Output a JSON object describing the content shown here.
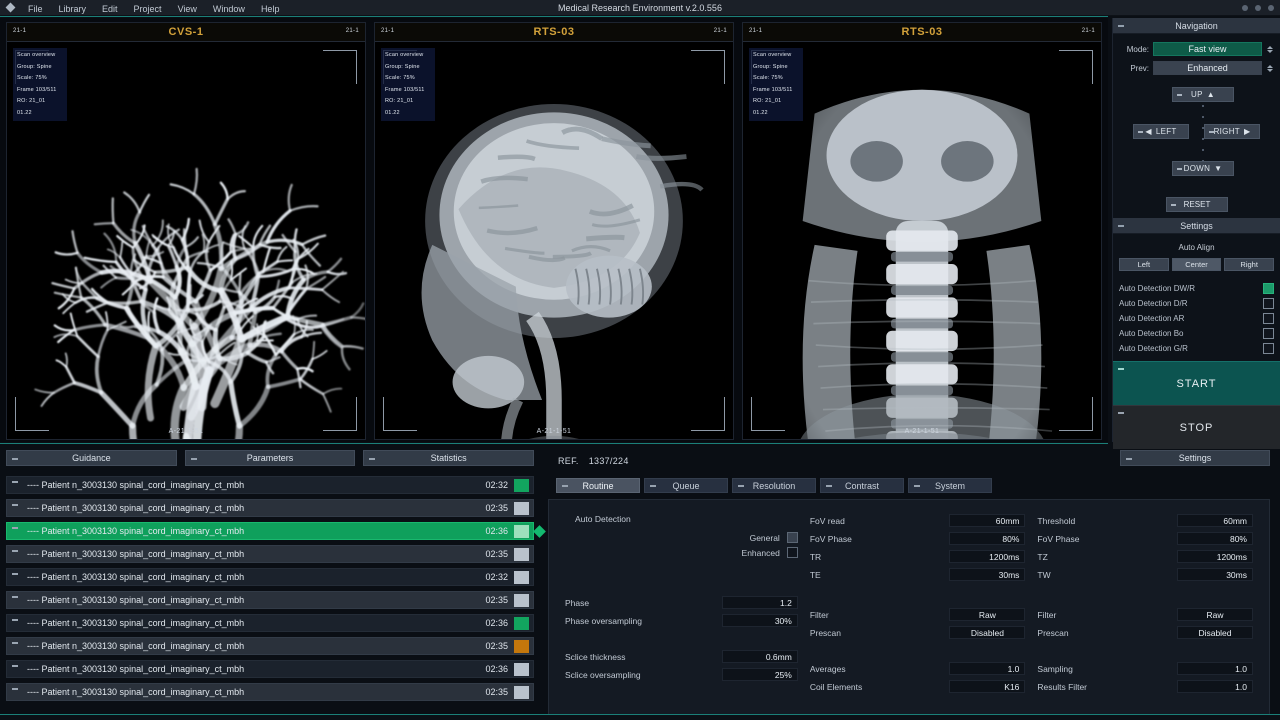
{
  "window": {
    "title": "Medical Research Environment v.2.0.556",
    "menu": [
      "File",
      "Library",
      "Edit",
      "Project",
      "View",
      "Window",
      "Help"
    ],
    "logo_icon": "diamond-icon"
  },
  "viewports": [
    {
      "name": "CVS-1",
      "series_left": "21-1",
      "series_right": "21-1",
      "footer": "A-21-1-51",
      "overlay": [
        "Scan overview",
        "Group: Spine",
        "Scale:  75%",
        "Frame 103/511",
        "RO: 21_01",
        "01.22"
      ]
    },
    {
      "name": "RTS-03",
      "series_left": "21-1",
      "series_right": "21-1",
      "footer": "A-21-1-51",
      "overlay": [
        "Scan overview",
        "Group: Spine",
        "Scale:  75%",
        "Frame 103/511",
        "RO: 21_01",
        "01.22"
      ]
    },
    {
      "name": "RTS-03",
      "series_left": "21-1",
      "series_right": "21-1",
      "footer": "A-21-1-51",
      "overlay": [
        "Scan overview",
        "Group: Spine",
        "Scale:  75%",
        "Frame 103/511",
        "RO: 21_01",
        "01.22"
      ]
    }
  ],
  "navigation": {
    "title": "Navigation",
    "mode_label": "Mode:",
    "mode_value": "Fast view",
    "prev_label": "Prev:",
    "prev_value": "Enhanced",
    "up": "UP",
    "left": "LEFT",
    "right": "RIGHT",
    "down": "DOWN",
    "reset": "RESET"
  },
  "settings": {
    "title": "Settings",
    "auto_align": "Auto Align",
    "align_options": [
      "Left",
      "Center",
      "Right"
    ],
    "align_selected": "Center",
    "detections": [
      {
        "label": "Auto Detection DW/R",
        "checked": true
      },
      {
        "label": "Auto Detection D/R",
        "checked": false
      },
      {
        "label": "Auto Detection AR",
        "checked": false
      },
      {
        "label": "Auto Detection Bo",
        "checked": false
      },
      {
        "label": "Auto Detection G/R",
        "checked": false
      }
    ],
    "start": "START",
    "stop": "STOP"
  },
  "lower_tabs": [
    "Guidance",
    "Parameters",
    "Statistics"
  ],
  "settings_button": "Settings",
  "patient_list": [
    {
      "name": "---- Patient n_3003130 spinal_cord_imaginary_ct_mbh",
      "time": "02:32",
      "status_color": "#12a55f",
      "selected": false,
      "style": "alt"
    },
    {
      "name": "---- Patient n_3003130 spinal_cord_imaginary_ct_mbh",
      "time": "02:35",
      "status_color": "#b9c2cc",
      "selected": false,
      "style": "normal"
    },
    {
      "name": "---- Patient n_3003130 spinal_cord_imaginary_ct_mbh",
      "time": "02:36",
      "status_color": "#9ce0bd",
      "selected": true,
      "style": "sel"
    },
    {
      "name": "---- Patient n_3003130 spinal_cord_imaginary_ct_mbh",
      "time": "02:35",
      "status_color": "#b9c2cc",
      "selected": false,
      "style": "normal"
    },
    {
      "name": "---- Patient n_3003130 spinal_cord_imaginary_ct_mbh",
      "time": "02:32",
      "status_color": "#b9c2cc",
      "selected": false,
      "style": "alt"
    },
    {
      "name": "---- Patient n_3003130 spinal_cord_imaginary_ct_mbh",
      "time": "02:35",
      "status_color": "#b9c2cc",
      "selected": false,
      "style": "normal"
    },
    {
      "name": "---- Patient n_3003130 spinal_cord_imaginary_ct_mbh",
      "time": "02:36",
      "status_color": "#12a55f",
      "selected": false,
      "style": "alt"
    },
    {
      "name": "---- Patient n_3003130 spinal_cord_imaginary_ct_mbh",
      "time": "02:35",
      "status_color": "#c4770c",
      "selected": false,
      "style": "normal"
    },
    {
      "name": "---- Patient n_3003130 spinal_cord_imaginary_ct_mbh",
      "time": "02:36",
      "status_color": "#b9c2cc",
      "selected": false,
      "style": "alt"
    },
    {
      "name": "---- Patient n_3003130 spinal_cord_imaginary_ct_mbh",
      "time": "02:35",
      "status_color": "#b9c2cc",
      "selected": false,
      "style": "normal"
    }
  ],
  "parameters": {
    "ref_label": "REF.",
    "ref_value": "1337/224",
    "tabs": [
      "Routine",
      "Queue",
      "Resolution",
      "Contrast",
      "System"
    ],
    "active_tab": "Routine",
    "auto_detection_title": "Auto Detection",
    "auto_detection": [
      {
        "label": "General",
        "checked": "half"
      },
      {
        "label": "Enhanced",
        "checked": "off"
      }
    ],
    "col1": [
      {
        "label": "Phase",
        "value": "1.2"
      },
      {
        "label": "Phase oversampling",
        "value": "30%"
      },
      {
        "label": "Sclice thickness",
        "value": "0.6mm"
      },
      {
        "label": "Sclice oversampling",
        "value": "25%"
      }
    ],
    "col2_group1": [
      {
        "label": "FoV read",
        "value": "60mm"
      },
      {
        "label": "FoV Phase",
        "value": "80%"
      },
      {
        "label": "TR",
        "value": "1200ms"
      },
      {
        "label": "TE",
        "value": "30ms"
      }
    ],
    "col2_group2": [
      {
        "label": "Filter",
        "value": "Raw"
      },
      {
        "label": "Prescan",
        "value": "Disabled"
      }
    ],
    "col2_group3": [
      {
        "label": "Averages",
        "value": "1.0"
      },
      {
        "label": "Coil Elements",
        "value": "K16"
      }
    ],
    "col3_group1": [
      {
        "label": "Threshold",
        "value": "60mm"
      },
      {
        "label": "FoV Phase",
        "value": "80%"
      },
      {
        "label": "TZ",
        "value": "1200ms"
      },
      {
        "label": "TW",
        "value": "30ms"
      }
    ],
    "col3_group2": [
      {
        "label": "Filter",
        "value": "Raw"
      },
      {
        "label": "Prescan",
        "value": "Disabled"
      }
    ],
    "col3_group3": [
      {
        "label": "Sampling",
        "value": "1.0"
      },
      {
        "label": "Results Filter",
        "value": "1.0"
      }
    ]
  },
  "colors": {
    "accent_teal": "#1b7f78",
    "accent_green": "#0fa05c",
    "viewport_title": "#d2a13a",
    "start_button": "#0c5450"
  }
}
